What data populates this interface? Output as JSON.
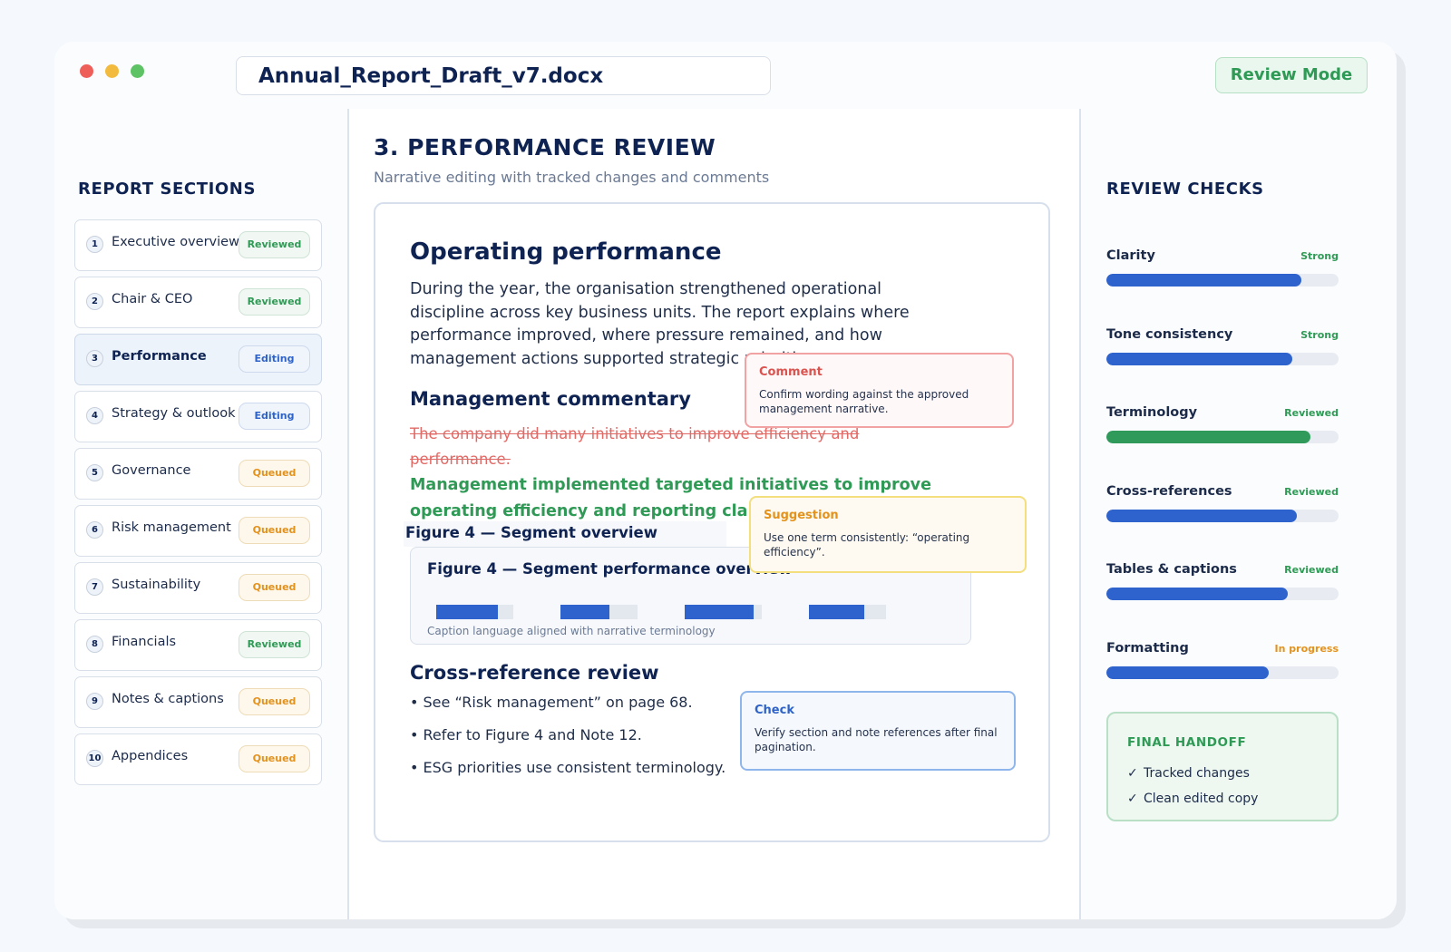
{
  "window": {
    "filename": "Annual_Report_Draft_v7.docx",
    "mode": "Review Mode"
  },
  "sidebar": {
    "title": "REPORT SECTIONS",
    "items": [
      {
        "num": "1",
        "label": "Executive overview",
        "status": "Reviewed"
      },
      {
        "num": "2",
        "label": "Chair & CEO",
        "status": "Reviewed"
      },
      {
        "num": "3",
        "label": "Performance",
        "status": "Editing",
        "active": true
      },
      {
        "num": "4",
        "label": "Strategy & outlook",
        "status": "Editing"
      },
      {
        "num": "5",
        "label": "Governance",
        "status": "Queued"
      },
      {
        "num": "6",
        "label": "Risk management",
        "status": "Queued"
      },
      {
        "num": "7",
        "label": "Sustainability",
        "status": "Queued"
      },
      {
        "num": "8",
        "label": "Financials",
        "status": "Reviewed"
      },
      {
        "num": "9",
        "label": "Notes & captions",
        "status": "Queued"
      },
      {
        "num": "10",
        "label": "Appendices",
        "status": "Queued"
      }
    ]
  },
  "main": {
    "title": "3. PERFORMANCE REVIEW",
    "subtitle": "Narrative editing with tracked changes and comments",
    "doc": {
      "heading": "Operating performance",
      "paragraph": "During the year, the organisation strengthened operational discipline across key business units. The report explains where performance improved, where pressure remained, and how management actions supported strategic priorities.",
      "commentary_heading": "Management commentary",
      "deleted_text": "The company did many initiatives to improve efficiency and performance.",
      "inserted_text": "Management implemented targeted initiatives to improve operating efficiency and reporting clarity.",
      "figure_tab": "Figure 4 — Segment overview",
      "figure_title": "Figure 4 — Segment performance overview",
      "figure_caption": "Caption language aligned with narrative terminology",
      "figure_bars": [
        0.8,
        0.63,
        0.89,
        0.72
      ],
      "crossref_heading": "Cross-reference review",
      "crossrefs": [
        "• See “Risk management” on page 68.",
        "• Refer to Figure 4 and Note 12.",
        "• ESG priorities use consistent terminology."
      ]
    },
    "annotations": {
      "comment": {
        "label": "Comment",
        "text": "Confirm wording against the approved management narrative."
      },
      "suggestion": {
        "label": "Suggestion",
        "text": "Use one term consistently: “operating efficiency”."
      },
      "check": {
        "label": "Check",
        "text": "Verify section and note references after final pagination."
      }
    }
  },
  "review": {
    "title": "REVIEW CHECKS",
    "metrics": [
      {
        "name": "Clarity",
        "status": "Strong",
        "value": 0.84,
        "status_color": "#2f9a55",
        "bar_color": "#2e62cc"
      },
      {
        "name": "Tone consistency",
        "status": "Strong",
        "value": 0.8,
        "status_color": "#2f9a55",
        "bar_color": "#2e62cc"
      },
      {
        "name": "Terminology",
        "status": "Reviewed",
        "value": 0.88,
        "status_color": "#2f9a55",
        "bar_color": "#2f9a5a"
      },
      {
        "name": "Cross-references",
        "status": "Reviewed",
        "value": 0.82,
        "status_color": "#2f9a55",
        "bar_color": "#2e62cc"
      },
      {
        "name": "Tables & captions",
        "status": "Reviewed",
        "value": 0.78,
        "status_color": "#2f9a55",
        "bar_color": "#2e62cc"
      },
      {
        "name": "Formatting",
        "status": "In progress",
        "value": 0.7,
        "status_color": "#e3921c",
        "bar_color": "#2e62cc"
      }
    ],
    "handoff": {
      "title": "FINAL HANDOFF",
      "items": [
        "Tracked changes",
        "Clean edited copy"
      ],
      "check_glyph": "✓"
    }
  }
}
